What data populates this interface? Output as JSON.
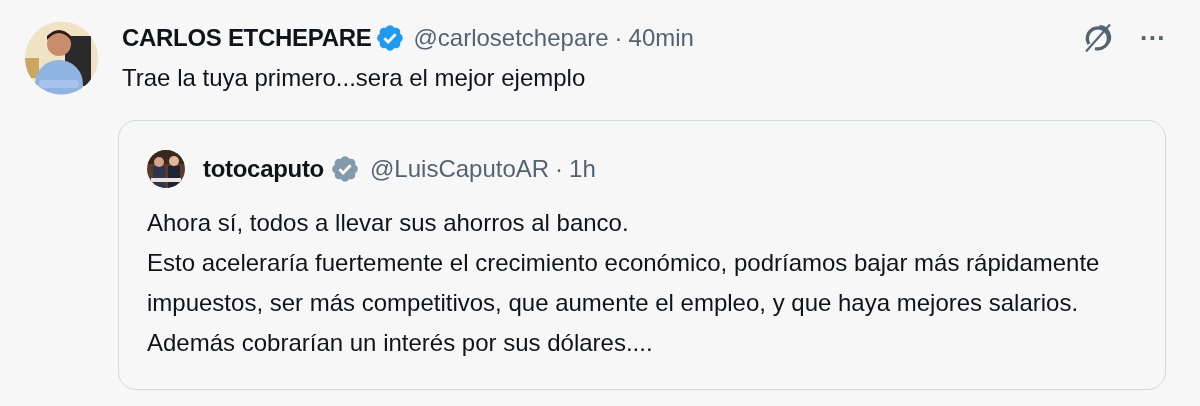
{
  "post": {
    "author": "CARLOS ETCHEPARE",
    "verified": true,
    "handle": "@carlosetchepare",
    "separator": "·",
    "time": "40min",
    "text": "Trae la tuya primero...sera el mejor ejemplo",
    "more": "···"
  },
  "quoted_post": {
    "author": "totocaputo",
    "verified": true,
    "handle": "@LuisCaputoAR",
    "separator": "·",
    "time": "1h",
    "paragraphs": [
      "Ahora sí, todos a llevar sus ahorros al banco.",
      "Esto aceleraría fuertemente el crecimiento económico, podríamos bajar más rápidamente impuestos, ser más competitivos, que aumente el empleo, y que haya mejores salarios.",
      "Además cobrarían un interés por sus dólares...."
    ]
  }
}
